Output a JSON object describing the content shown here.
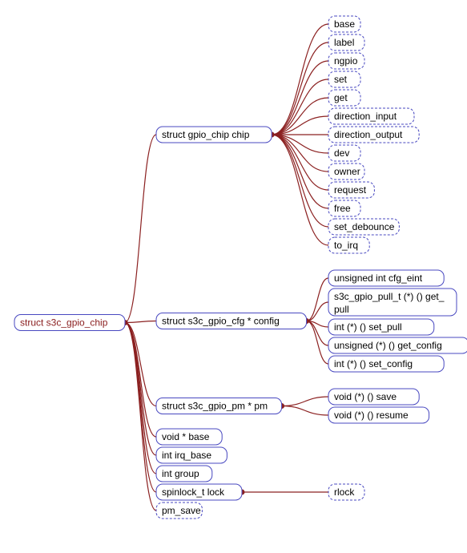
{
  "root": {
    "label": "struct s3c_gpio_chip"
  },
  "level1": [
    {
      "id": "chip",
      "label": "struct gpio_chip chip",
      "dashed": false,
      "children_key": "chip_children"
    },
    {
      "id": "config",
      "label": "struct s3c_gpio_cfg * config",
      "dashed": false,
      "children_key": "config_children"
    },
    {
      "id": "pm",
      "label": "struct s3c_gpio_pm * pm",
      "dashed": false,
      "children_key": "pm_children"
    },
    {
      "id": "basep",
      "label": "void * base",
      "dashed": false,
      "children_key": null
    },
    {
      "id": "irqbase",
      "label": "int irq_base",
      "dashed": false,
      "children_key": null
    },
    {
      "id": "group",
      "label": "int group",
      "dashed": false,
      "children_key": null
    },
    {
      "id": "lock",
      "label": "spinlock_t lock",
      "dashed": false,
      "children_key": "lock_children"
    },
    {
      "id": "pmsave",
      "label": "pm_save",
      "dashed": true,
      "children_key": null
    }
  ],
  "chip_children": [
    {
      "label": "base",
      "dashed": true
    },
    {
      "label": "label",
      "dashed": true
    },
    {
      "label": "ngpio",
      "dashed": true
    },
    {
      "label": "set",
      "dashed": true
    },
    {
      "label": "get",
      "dashed": true
    },
    {
      "label": "direction_input",
      "dashed": true
    },
    {
      "label": "direction_output",
      "dashed": true
    },
    {
      "label": "dev",
      "dashed": true
    },
    {
      "label": "owner",
      "dashed": true
    },
    {
      "label": "request",
      "dashed": true
    },
    {
      "label": "free",
      "dashed": true
    },
    {
      "label": "set_debounce",
      "dashed": true
    },
    {
      "label": "to_irq",
      "dashed": true
    }
  ],
  "config_children": [
    {
      "label": "unsigned int cfg_eint",
      "dashed": false
    },
    {
      "label": "s3c_gpio_pull_t (*) () get_pull",
      "dashed": false,
      "twoLine": true
    },
    {
      "label": "int (*) () set_pull",
      "dashed": false
    },
    {
      "label": "unsigned (*) () get_config",
      "dashed": false
    },
    {
      "label": "int (*) () set_config",
      "dashed": false
    }
  ],
  "pm_children": [
    {
      "label": "void (*) () save",
      "dashed": false
    },
    {
      "label": "void (*) () resume",
      "dashed": false
    }
  ],
  "lock_children": [
    {
      "label": "rlock",
      "dashed": true
    }
  ]
}
